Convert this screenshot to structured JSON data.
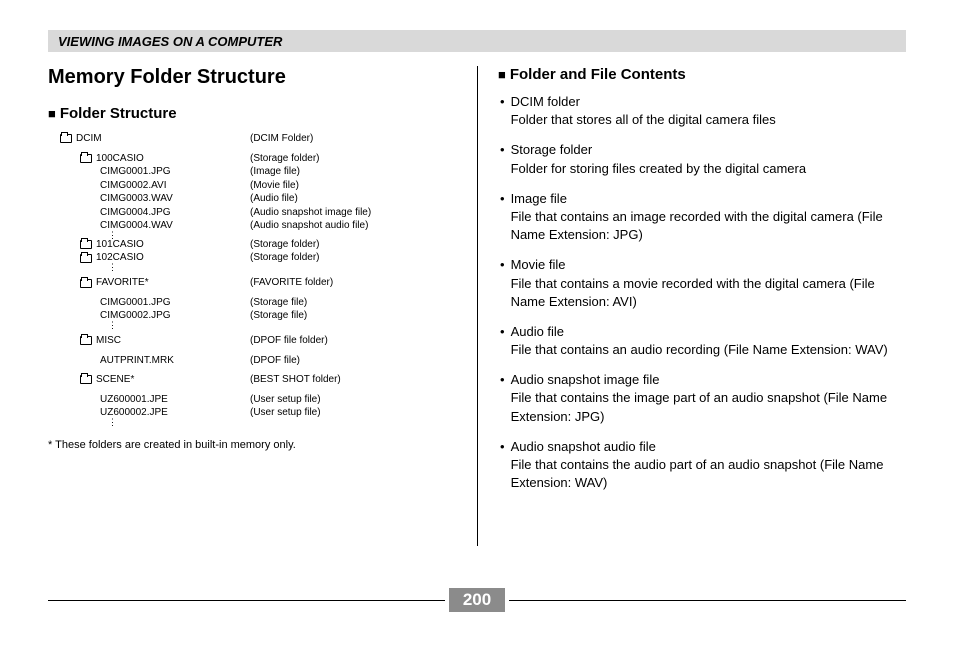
{
  "header": "VIEWING IMAGES ON A COMPUTER",
  "page_number": "200",
  "left": {
    "title": "Memory Folder Structure",
    "subhead": "Folder Structure",
    "footnote": "* These folders are created in built-in memory only."
  },
  "tree": [
    {
      "indent": 0,
      "folder": true,
      "name": "DCIM",
      "desc": "(DCIM Folder)",
      "type": "row"
    },
    {
      "type": "spacer"
    },
    {
      "indent": 1,
      "folder": true,
      "name": "100CASIO",
      "desc": "(Storage folder)",
      "type": "row"
    },
    {
      "indent": 2,
      "folder": false,
      "name": "CIMG0001.JPG",
      "desc": "(Image file)",
      "type": "row"
    },
    {
      "indent": 2,
      "folder": false,
      "name": "CIMG0002.AVI",
      "desc": "(Movie file)",
      "type": "row"
    },
    {
      "indent": 2,
      "folder": false,
      "name": "CIMG0003.WAV",
      "desc": "(Audio file)",
      "type": "row"
    },
    {
      "indent": 2,
      "folder": false,
      "name": "CIMG0004.JPG",
      "desc": "(Audio snapshot image file)",
      "type": "row"
    },
    {
      "indent": 2,
      "folder": false,
      "name": "CIMG0004.WAV",
      "desc": "(Audio snapshot audio file)",
      "type": "row"
    },
    {
      "type": "vdots"
    },
    {
      "indent": 1,
      "folder": true,
      "name": "101CASIO",
      "desc": "(Storage folder)",
      "type": "row"
    },
    {
      "indent": 1,
      "folder": true,
      "name": "102CASIO",
      "desc": "(Storage folder)",
      "type": "row"
    },
    {
      "type": "vdots"
    },
    {
      "type": "spacer"
    },
    {
      "indent": 1,
      "folder": true,
      "name": "FAVORITE*",
      "desc": "(FAVORITE folder)",
      "type": "row"
    },
    {
      "type": "spacer"
    },
    {
      "indent": 2,
      "folder": false,
      "name": "CIMG0001.JPG",
      "desc": "(Storage file)",
      "type": "row"
    },
    {
      "indent": 2,
      "folder": false,
      "name": "CIMG0002.JPG",
      "desc": "(Storage file)",
      "type": "row"
    },
    {
      "type": "vdots"
    },
    {
      "type": "spacer"
    },
    {
      "indent": 1,
      "folder": true,
      "name": "MISC",
      "desc": "(DPOF file folder)",
      "type": "row"
    },
    {
      "type": "spacer"
    },
    {
      "indent": 2,
      "folder": false,
      "name": "AUTPRINT.MRK",
      "desc": "(DPOF file)",
      "type": "row"
    },
    {
      "type": "spacer"
    },
    {
      "indent": 1,
      "folder": true,
      "name": "SCENE*",
      "desc": "(BEST SHOT folder)",
      "type": "row"
    },
    {
      "type": "spacer"
    },
    {
      "indent": 2,
      "folder": false,
      "name": "UZ600001.JPE",
      "desc": "(User setup file)",
      "type": "row"
    },
    {
      "indent": 2,
      "folder": false,
      "name": "UZ600002.JPE",
      "desc": "(User setup file)",
      "type": "row"
    },
    {
      "type": "vdots"
    }
  ],
  "right": {
    "subhead": "Folder and File Contents",
    "items": [
      {
        "term": "DCIM folder",
        "desc": "Folder that stores all of the digital camera files"
      },
      {
        "term": "Storage folder",
        "desc": "Folder for storing files created by the digital camera"
      },
      {
        "term": "Image file",
        "desc": "File that contains an image recorded with the digital camera (File Name Extension: JPG)"
      },
      {
        "term": "Movie file",
        "desc": "File that contains a movie recorded with the digital camera (File Name Extension: AVI)"
      },
      {
        "term": "Audio file",
        "desc": "File that contains an audio recording (File Name Extension: WAV)"
      },
      {
        "term": "Audio snapshot image file",
        "desc": "File that contains the image part of an audio snapshot (File Name Extension: JPG)"
      },
      {
        "term": "Audio snapshot audio file",
        "desc": "File that contains the audio part of an audio snapshot (File Name Extension: WAV)"
      }
    ]
  }
}
